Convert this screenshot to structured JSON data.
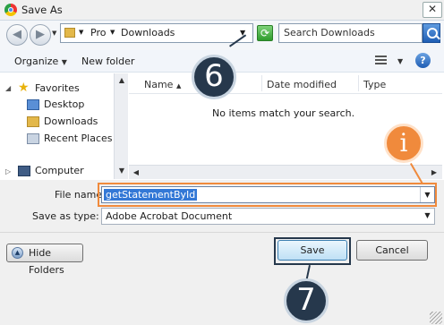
{
  "window": {
    "title": "Save As",
    "close_glyph": "✕"
  },
  "nav": {
    "back_glyph": "◀",
    "forward_glyph": "▶",
    "breadcrumb": [
      "Pro",
      "Downloads"
    ],
    "refresh_glyph": "⟳",
    "search_placeholder": "Search Downloads"
  },
  "toolbar": {
    "organize_label": "Organize",
    "new_folder_label": "New folder"
  },
  "sidebar": {
    "favorites_label": "Favorites",
    "items": [
      {
        "label": "Desktop",
        "icon": "desktop-icon"
      },
      {
        "label": "Downloads",
        "icon": "downloads-folder-icon"
      },
      {
        "label": "Recent Places",
        "icon": "recent-places-icon"
      }
    ],
    "computer_label": "Computer"
  },
  "file_list": {
    "columns": [
      "Name",
      "Date modified",
      "Type"
    ],
    "sort_glyph": "▲",
    "empty_message": "No items match your search."
  },
  "form": {
    "filename_label": "File name:",
    "filename_value": "getStatementById",
    "savetype_label": "Save as type:",
    "savetype_value": "Adobe Acrobat Document"
  },
  "buttons": {
    "hide_folders": "Hide Folders",
    "save": "Save",
    "cancel": "Cancel"
  },
  "callouts": {
    "step_a": "6",
    "info": "i",
    "step_b": "7"
  },
  "colors": {
    "callout_dark": "#26384c",
    "callout_orange": "#f08a3c",
    "selection": "#3378d6",
    "highlight_border": "#f08a3c"
  }
}
